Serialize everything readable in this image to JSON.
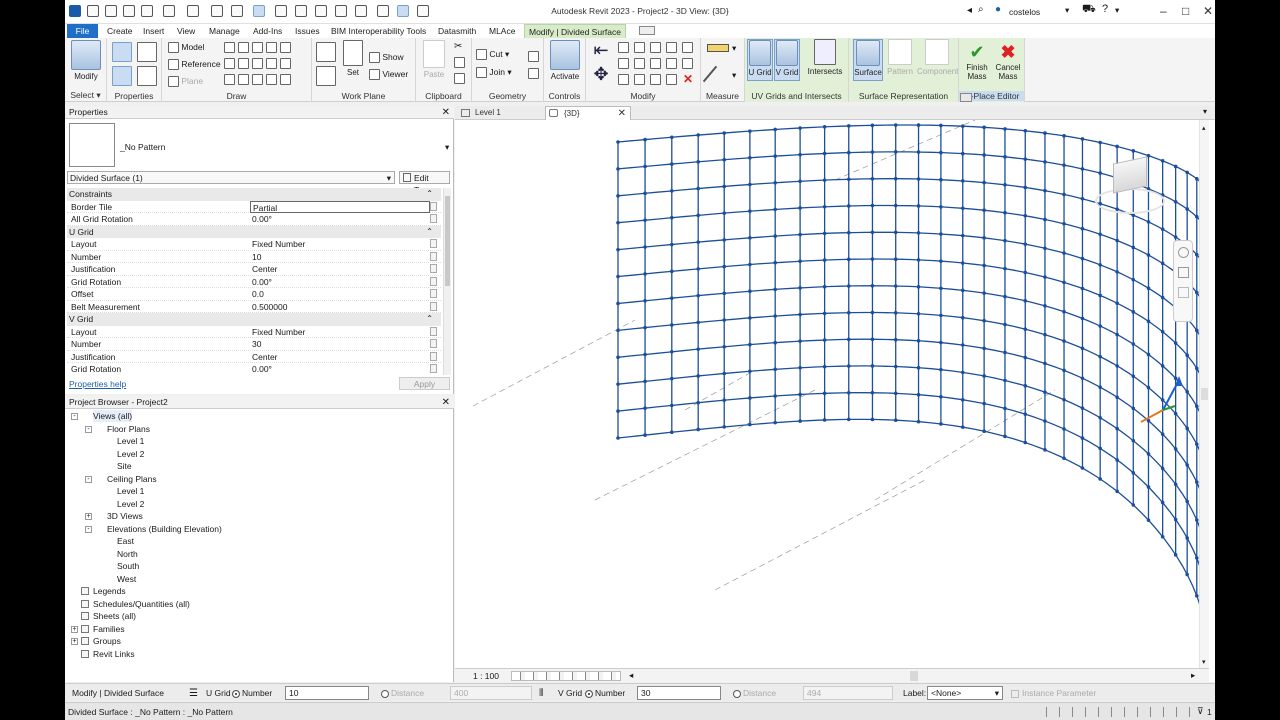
{
  "app": {
    "title": "Autodesk Revit 2023 - Project2 - 3D View: {3D}",
    "user": "costelos"
  },
  "ribbon_tabs": [
    "File",
    "Create",
    "Insert",
    "View",
    "Manage",
    "Add-Ins",
    "Issues",
    "BIM Interoperability Tools",
    "Datasmith",
    "MLAce",
    "Modify | Divided Surface"
  ],
  "ribbon": {
    "select": {
      "modify": "Modify",
      "label": "Select"
    },
    "properties": {
      "label": "Properties"
    },
    "draw": {
      "model": "Model",
      "reference": "Reference",
      "plane": "Plane",
      "label": "Draw"
    },
    "work_plane": {
      "set": "Set",
      "show": "Show",
      "viewer": "Viewer",
      "label": "Work Plane"
    },
    "clipboard": {
      "paste": "Paste",
      "label": "Clipboard"
    },
    "geometry": {
      "cut": "Cut",
      "join": "Join",
      "label": "Geometry"
    },
    "controls": {
      "activate": "Activate",
      "label": "Controls"
    },
    "modify": {
      "label": "Modify"
    },
    "measure": {
      "label": "Measure"
    },
    "uv": {
      "u_grid": "U Grid",
      "v_grid": "V Grid",
      "intersects": "Intersects",
      "label": "UV Grids and Intersects"
    },
    "surface_rep": {
      "surface": "Surface",
      "pattern": "Pattern",
      "component": "Component",
      "label": "Surface Representation"
    },
    "in_place": {
      "finish": "Finish",
      "finish2": "Mass",
      "cancel": "Cancel",
      "cancel2": "Mass",
      "label": "In-Place Editor"
    }
  },
  "properties": {
    "title": "Properties",
    "type_name": "_No Pattern",
    "instance_selector": "Divided Surface (1)",
    "edit_type": "Edit Type",
    "sections": [
      {
        "name": "Constraints",
        "rows": [
          {
            "k": "Border Tile",
            "v": "Partial"
          },
          {
            "k": "All Grid Rotation",
            "v": "0.00°"
          }
        ]
      },
      {
        "name": "U Grid",
        "rows": [
          {
            "k": "Layout",
            "v": "Fixed Number"
          },
          {
            "k": "Number",
            "v": "10"
          },
          {
            "k": "Justification",
            "v": "Center"
          },
          {
            "k": "Grid Rotation",
            "v": "0.00°"
          },
          {
            "k": "Offset",
            "v": "0.0"
          },
          {
            "k": "Belt Measurement",
            "v": "0.500000"
          }
        ]
      },
      {
        "name": "V Grid",
        "rows": [
          {
            "k": "Layout",
            "v": "Fixed Number"
          },
          {
            "k": "Number",
            "v": "30"
          },
          {
            "k": "Justification",
            "v": "Center"
          },
          {
            "k": "Grid Rotation",
            "v": "0.00°"
          }
        ]
      }
    ],
    "help": "Properties help",
    "apply": "Apply"
  },
  "browser": {
    "title": "Project Browser - Project2",
    "items": [
      {
        "label": "Views (all)",
        "level": 0,
        "toggle": "-"
      },
      {
        "label": "Floor Plans",
        "level": 1,
        "toggle": "-"
      },
      {
        "label": "Level 1",
        "level": 2
      },
      {
        "label": "Level 2",
        "level": 2
      },
      {
        "label": "Site",
        "level": 2
      },
      {
        "label": "Ceiling Plans",
        "level": 1,
        "toggle": "-"
      },
      {
        "label": "Level 1",
        "level": 2
      },
      {
        "label": "Level 2",
        "level": 2
      },
      {
        "label": "3D Views",
        "level": 1,
        "toggle": "+"
      },
      {
        "label": "Elevations (Building Elevation)",
        "level": 1,
        "toggle": "-"
      },
      {
        "label": "East",
        "level": 2
      },
      {
        "label": "North",
        "level": 2
      },
      {
        "label": "South",
        "level": 2
      },
      {
        "label": "West",
        "level": 2
      },
      {
        "label": "Legends",
        "level": 0
      },
      {
        "label": "Schedules/Quantities (all)",
        "level": 0
      },
      {
        "label": "Sheets (all)",
        "level": 0
      },
      {
        "label": "Families",
        "level": 0,
        "toggle": "+"
      },
      {
        "label": "Groups",
        "level": 0,
        "toggle": "+"
      },
      {
        "label": "Revit Links",
        "level": 0
      }
    ]
  },
  "view_tabs": [
    "Level 1",
    "{3D}"
  ],
  "view": {
    "scale": "1 : 100"
  },
  "options_bar": {
    "mode": "Modify | Divided Surface",
    "u_grid": "U Grid",
    "number": "Number",
    "u_number": "10",
    "distance": "Distance",
    "u_distance": "400",
    "v_grid": "V Grid",
    "v_number": "30",
    "v_distance": "494",
    "label": "Label:",
    "label_value": "<None>",
    "instance_param": "Instance Parameter"
  },
  "status": {
    "text": "Divided Surface : _No Pattern : _No Pattern",
    "filter_count": "1"
  },
  "grid": {
    "u_lines": 10,
    "v_lines": 30,
    "color": "#1d4f99"
  }
}
